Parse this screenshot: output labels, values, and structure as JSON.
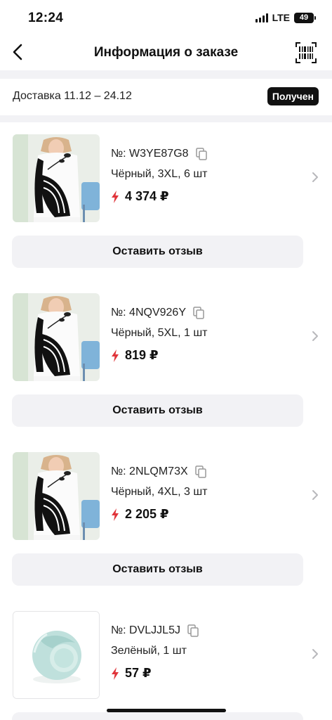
{
  "status_bar": {
    "time": "12:24",
    "network": "LTE",
    "battery": "49"
  },
  "nav": {
    "title": "Информация о заказе",
    "back_icon": "chevron-left-icon",
    "barcode_icon": "barcode-icon"
  },
  "delivery": {
    "text": "Доставка 11.12 – 24.12",
    "status": "Получен"
  },
  "items": [
    {
      "sku": "№: W3YE87G8",
      "variant": "Чёрный, 3XL, 6 шт",
      "price": "4 374 ₽",
      "review_label": "Оставить отзыв",
      "image": "black-white-blouse"
    },
    {
      "sku": "№: 4NQV926Y",
      "variant": "Чёрный, 5XL, 1 шт",
      "price": "819 ₽",
      "review_label": "Оставить отзыв",
      "image": "black-white-blouse"
    },
    {
      "sku": "№: 2NLQM73X",
      "variant": "Чёрный, 4XL, 3 шт",
      "price": "2 205 ₽",
      "review_label": "Оставить отзыв",
      "image": "black-white-blouse"
    },
    {
      "sku": "№: DVLJJL5J",
      "variant": "Зелёный, 1 шт",
      "price": "57 ₽",
      "image": "green-plastic-ball"
    }
  ],
  "colors": {
    "accent_red": "#e0343a",
    "badge_bg": "#111111",
    "button_bg": "#f2f2f5"
  }
}
